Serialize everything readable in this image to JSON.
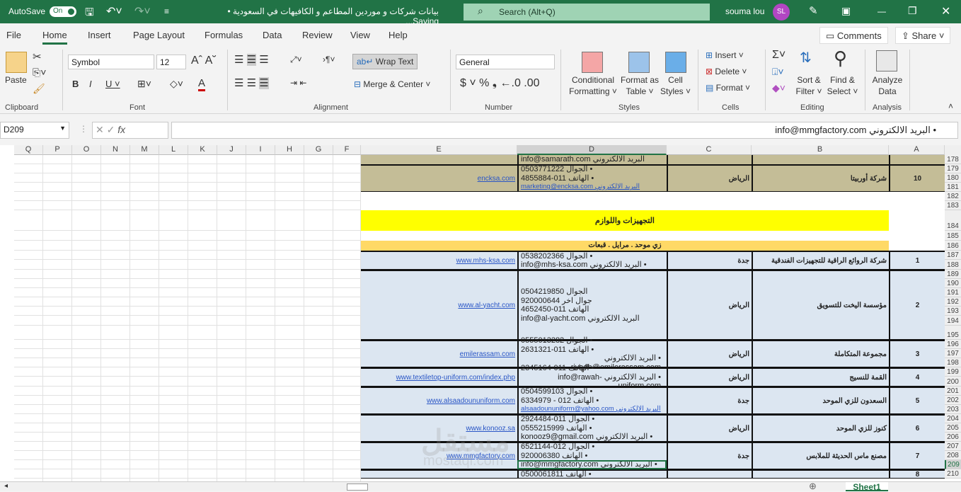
{
  "titlebar": {
    "autosave": "AutoSave",
    "toggle": "On",
    "title": "بيانات شركات و موردين المطاعم و الكافيهات في السعودية • Saving...",
    "search": "Search (Alt+Q)",
    "user": "souma lou",
    "initials": "SL"
  },
  "menu": {
    "tabs": [
      "File",
      "Home",
      "Insert",
      "Page Layout",
      "Formulas",
      "Data",
      "Review",
      "View",
      "Help"
    ],
    "active": "Home",
    "comments": "Comments",
    "share": "Share"
  },
  "ribbon": {
    "paste": "Paste",
    "font": "Symbol",
    "size": "12",
    "wrap": "Wrap Text",
    "merge": "Merge & Center",
    "number_format": "General",
    "cf": [
      "Conditional",
      "Formatting ˅"
    ],
    "fat": [
      "Format as",
      "Table ˅"
    ],
    "cs": [
      "Cell",
      "Styles ˅"
    ],
    "insert": "Insert",
    "delete": "Delete",
    "format": "Format",
    "sort": [
      "Sort &",
      "Filter ˅"
    ],
    "find": [
      "Find &",
      "Select ˅"
    ],
    "analyze": [
      "Analyze",
      "Data"
    ],
    "groups": [
      "Clipboard",
      "Font",
      "Alignment",
      "Number",
      "Styles",
      "Cells",
      "Editing",
      "Analysis"
    ]
  },
  "formula": {
    "namebox": "D209",
    "content": "• البريد الالكتروني info@mmgfactory.com"
  },
  "columns": [
    "Q",
    "P",
    "O",
    "N",
    "M",
    "L",
    "K",
    "J",
    "I",
    "H",
    "G",
    "F",
    "E",
    "D",
    "C",
    "B",
    "A"
  ],
  "rows": [
    "178",
    "179",
    "180",
    "181",
    "182",
    "183",
    "184",
    "185",
    "186",
    "187",
    "188",
    "189",
    "190",
    "191",
    "192",
    "193",
    "194",
    "195",
    "196",
    "197",
    "198",
    "199",
    "200",
    "201",
    "202",
    "203",
    "204",
    "205",
    "206",
    "207",
    "208",
    "209",
    "210"
  ],
  "colors": {
    "brand": "#217346",
    "tan": "#c4bd97",
    "yellow": "#ffff00",
    "orange": "#ffd966",
    "blue": "#dce6f1"
  },
  "section": {
    "title": "التجهيزات واللوازم",
    "subtitle": "زي موحد . مرايل . قبعات"
  },
  "partial": {
    "line": "البريد الالكتروني info@samarath.com"
  },
  "records": [
    {
      "num": "10",
      "name": "شركة أوربيتا",
      "city": "الرياض",
      "lines": [
        "• الجوال 0503771222",
        "• الهاتف 011-4855884",
        "البريد الالكتروني marketing@encksa.com"
      ],
      "web": " encksa.com"
    },
    {
      "num": "1",
      "name": "شركة الروائع الراقية للتجهيزات الفندقية",
      "city": "جدة",
      "lines": [
        "• الجوال 0538202366",
        "• البريد الالكتروني info@mhs-ksa.com"
      ],
      "web": " www.mhs-ksa.com"
    },
    {
      "num": "2",
      "name": "مؤسسة اليخت للتسويق",
      "city": "الرياض",
      "lines": [
        "الجوال 0504219850",
        "جوال اخر 920000644",
        "الهاتف 011-4652450",
        "البريد الالكتروني info@al-yacht.com"
      ],
      "web": " www.al-yacht.com"
    },
    {
      "num": "3",
      "name": "مجموعة المتكاملة",
      "city": "الرياض",
      "lines": [
        "• الجوال 0555013282",
        "• الهاتف 011-2631321",
        "• البريد الالكتروني riyadh@emilerassam.com"
      ],
      "web": " emilerassam.com"
    },
    {
      "num": "4",
      "name": "القمة للنسيج",
      "city": "الرياض",
      "lines": [
        "• الهاتف 011-2345164",
        "• البريد الالكتروني info@rawah-uniform.com"
      ],
      "web": " www.textiletop-uniform.com/index.php"
    },
    {
      "num": "5",
      "name": "السعدون للزي الموحد",
      "city": "جدة",
      "lines": [
        "• الجوال 0504599103",
        "• الهاتف 012 - 6334979",
        "البريد الالكتروني alsaadoununiform@yahoo.com"
      ],
      "web": " www.alsaadoununiform.com"
    },
    {
      "num": "6",
      "name": "كنوز للزي الموحد",
      "city": "الرياض",
      "lines": [
        "• الجوال 011-2924484",
        "• الهاتف 0555215999",
        "• البريد الالكتروني konooz9@gmail.com"
      ],
      "web": " www.konooz.sa"
    },
    {
      "num": "7",
      "name": "مصنع ماس الحديثة للملابس",
      "city": "جدة",
      "lines": [
        "• الجوال 012-6521144",
        "• الهاتف 920006380",
        "• البريد الالكتروني info@mmgfactory.com"
      ],
      "web": " www.mmgfactory.com"
    },
    {
      "num": "8",
      "name": "",
      "city": "",
      "lines": [
        "• الهاتف 0500061811"
      ],
      "web": ""
    }
  ],
  "sheet": {
    "tab": "Sheet1"
  },
  "watermark": {
    "ar": "مستقل",
    "en": "mostaql.com"
  }
}
